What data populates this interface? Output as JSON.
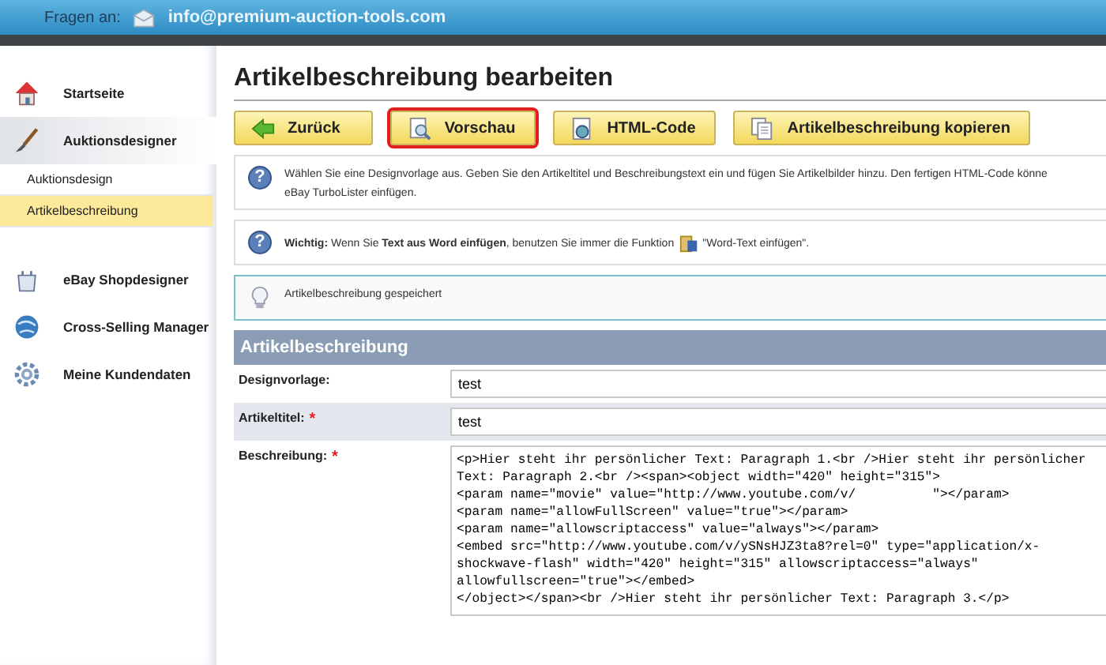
{
  "top_bar": {
    "label": "Fragen an:",
    "email": "info@premium-auction-tools.com"
  },
  "sidebar": {
    "items": [
      {
        "label": "Startseite",
        "selected": false
      },
      {
        "label": "Auktionsdesigner",
        "selected": true,
        "children": [
          {
            "label": "Auktionsdesign",
            "selected": false
          },
          {
            "label": "Artikelbeschreibung",
            "selected": true
          }
        ]
      },
      {
        "label": "eBay Shopdesigner",
        "selected": false
      },
      {
        "label": "Cross-Selling Manager",
        "selected": false
      },
      {
        "label": "Meine Kundendaten",
        "selected": false
      }
    ]
  },
  "page_title": "Artikelbeschreibung bearbeiten",
  "toolbar": [
    {
      "label": "Zurück",
      "highlighted": false
    },
    {
      "label": "Vorschau",
      "highlighted": true
    },
    {
      "label": "HTML-Code",
      "highlighted": false
    },
    {
      "label": "Artikelbeschreibung kopieren",
      "highlighted": false
    }
  ],
  "notices": [
    {
      "kind": "help",
      "icon": "?",
      "lines": [
        "Wählen Sie eine Designvorlage aus. Geben Sie den Artikeltitel und Beschreibungstext ein und fügen Sie Artikelbilder hinzu. Den fertigen HTML-Code könne",
        "eBay TurboLister einfügen."
      ]
    },
    {
      "kind": "help",
      "icon": "?",
      "lines": [
        "**Wichtig:** Wenn Sie **Text aus Word einfügen**, benutzen Sie immer die Funktion"
      ],
      "tail": "\"Word-Text einfügen\"."
    },
    {
      "kind": "success",
      "lines": [
        "Artikelbeschreibung gespeichert"
      ]
    }
  ],
  "form": {
    "title": "Artikelbeschreibung",
    "fields": [
      {
        "label": "Designvorlage:",
        "kind": "text",
        "value": "test"
      },
      {
        "label": "Artikeltitel:",
        "required_mark": "*",
        "kind": "text",
        "value": "test"
      },
      {
        "label": "Beschreibung:",
        "required_mark": "*",
        "kind": "code",
        "value": "<p>Hier steht ihr persönlicher Text: Paragraph 1.<br />Hier steht ihr persönlicher\nText: Paragraph 2.<br /><span><object width=\"420\" height=\"315\">\n<param name=\"movie\" value=\"http://www.youtube.com/v/          \"></param>\n<param name=\"allowFullScreen\" value=\"true\"></param>\n<param name=\"allowscriptaccess\" value=\"always\"></param>\n<embed src=\"http://www.youtube.com/v/ySNsHJZ3ta8?rel=0\" type=\"application/x-\nshockwave-flash\" width=\"420\" height=\"315\" allowscriptaccess=\"always\"\nallowfullscreen=\"true\"></embed>\n</object></span><br />Hier steht ihr persönlicher Text: Paragraph 3.</p>"
      }
    ]
  }
}
